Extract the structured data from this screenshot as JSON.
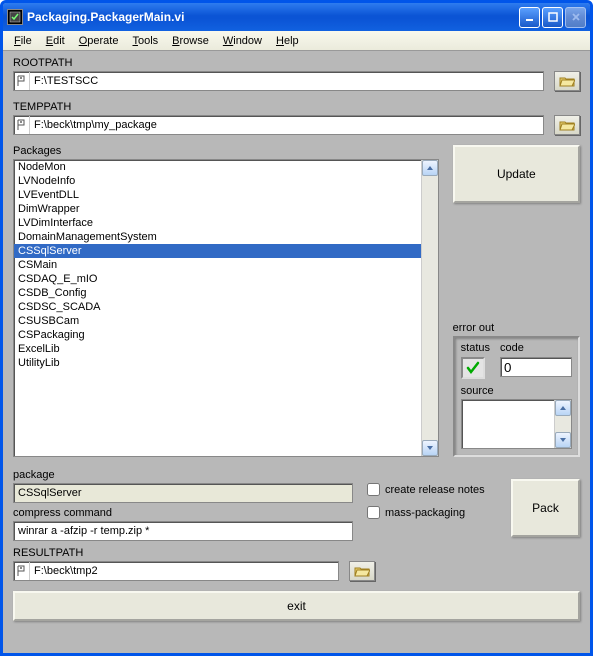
{
  "window": {
    "title": "Packaging.PackagerMain.vi"
  },
  "menubar": [
    "File",
    "Edit",
    "Operate",
    "Tools",
    "Browse",
    "Window",
    "Help"
  ],
  "rootpath": {
    "label": "ROOTPATH",
    "value": "F:\\TESTSCC"
  },
  "temppath": {
    "label": "TEMPPATH",
    "value": "F:\\beck\\tmp\\my_package"
  },
  "packages": {
    "label": "Packages",
    "items": [
      "NodeMon",
      "LVNodeInfo",
      "LVEventDLL",
      "DimWrapper",
      "LVDimInterface",
      "DomainManagementSystem",
      "CSSqlServer",
      "CSMain",
      "CSDAQ_E_mIO",
      "CSDB_Config",
      "CSDSC_SCADA",
      "CSUSBCam",
      "CSPackaging",
      "ExcelLib",
      "UtilityLib"
    ],
    "selected_index": 6
  },
  "update_btn": "Update",
  "error_out": {
    "label": "error out",
    "status_label": "status",
    "code_label": "code",
    "code_value": "0",
    "source_label": "source",
    "source_value": ""
  },
  "package_field": {
    "label": "package",
    "value": "CSSqlServer"
  },
  "compress": {
    "label": "compress command",
    "value": "winrar a -afzip -r temp.zip *"
  },
  "checkboxes": {
    "release_notes": {
      "label": "create release notes",
      "checked": false
    },
    "mass_packaging": {
      "label": "mass-packaging",
      "checked": false
    }
  },
  "pack_btn": "Pack",
  "resultpath": {
    "label": "RESULTPATH",
    "value": "F:\\beck\\tmp2"
  },
  "exit_btn": "exit"
}
